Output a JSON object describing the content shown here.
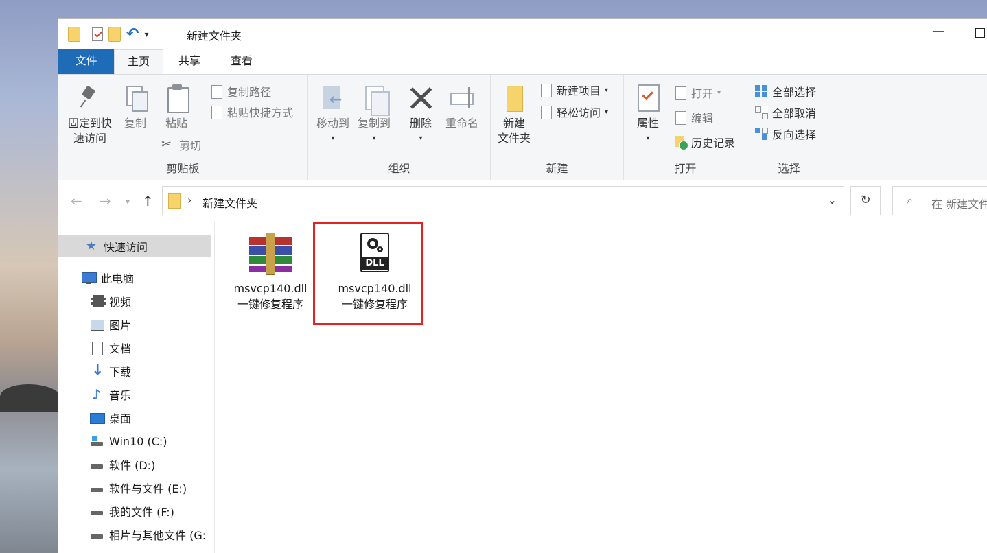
{
  "window": {
    "title": "新建文件夹"
  },
  "tabs": [
    "文件",
    "主页",
    "共享",
    "查看"
  ],
  "ribbon": {
    "clipboard": {
      "label": "剪贴板",
      "pin": "固定到快\n速访问",
      "pin_l1": "固定到快",
      "pin_l2": "速访问",
      "copy": "复制",
      "paste": "粘贴",
      "copy_path": "复制路径",
      "paste_shortcut": "粘贴快捷方式",
      "cut": "剪切"
    },
    "organize": {
      "label": "组织",
      "move_to": "移动到",
      "copy_to": "复制到",
      "delete": "删除",
      "rename": "重命名"
    },
    "new": {
      "label": "新建",
      "new_folder_l1": "新建",
      "new_folder_l2": "文件夹",
      "new_item": "新建项目",
      "easy_access": "轻松访问"
    },
    "open": {
      "label": "打开",
      "properties": "属性",
      "open": "打开",
      "edit": "编辑",
      "history": "历史记录"
    },
    "select": {
      "label": "选择",
      "select_all": "全部选择",
      "select_none": "全部取消",
      "invert": "反向选择"
    }
  },
  "address": {
    "path": "新建文件夹",
    "search_placeholder": "在 新建文件夹"
  },
  "nav": {
    "quick_access": "快速访问",
    "this_pc": "此电脑",
    "items": [
      "视频",
      "图片",
      "文档",
      "下载",
      "音乐",
      "桌面",
      "Win10 (C:)",
      "软件 (D:)",
      "软件与文件 (E:)",
      "我的文件 (F:)",
      "相片与其他文件 (G:"
    ]
  },
  "files": [
    {
      "name_l1": "msvcp140.dll",
      "name_l2": "一键修复程序",
      "icon": "winrar-archive-icon"
    },
    {
      "name_l1": "msvcp140.dll",
      "name_l2": "一键修复程序",
      "icon": "dll-file-icon"
    }
  ],
  "colors": {
    "accent": "#1e6bb8",
    "highlight": "#e52222"
  }
}
